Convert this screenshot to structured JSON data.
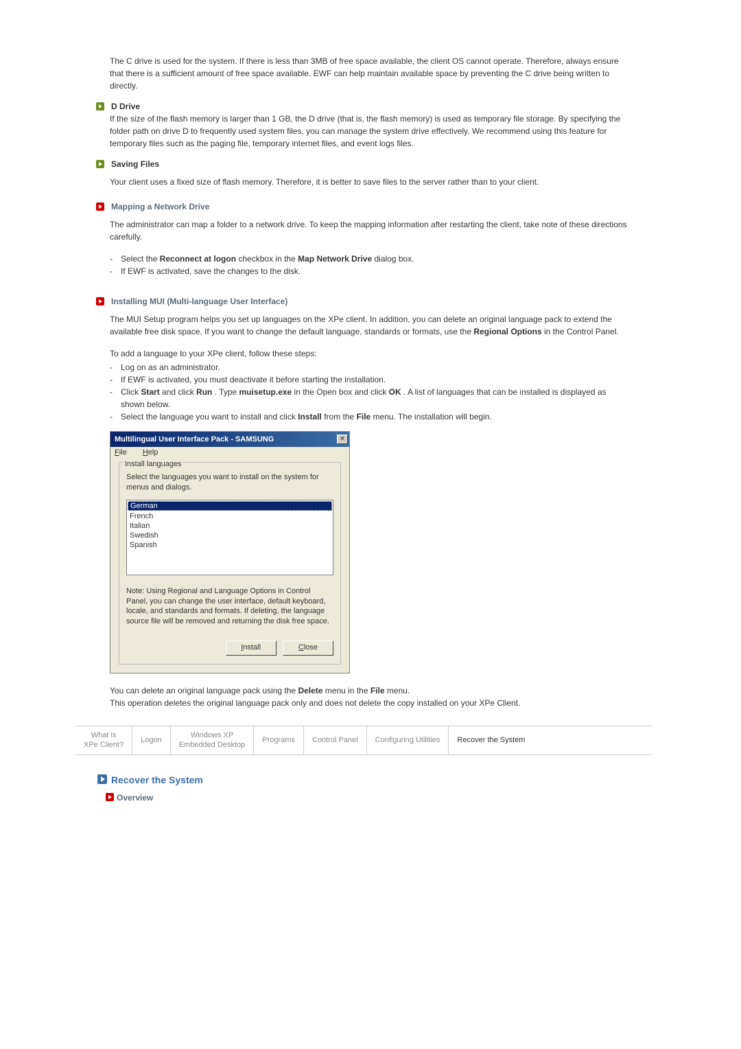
{
  "intro_paragraph": "The C drive is used for the system. If there is less than 3MB of free space available, the client OS cannot operate. Therefore, always ensure that there is a sufficient amount of free space available. EWF can help maintain available space by preventing the C drive being written to directly.",
  "ddrive": {
    "title": "D Drive",
    "text": "If the size of the flash memory is larger than 1 GB, the D drive (that is, the flash memory) is used as temporary file storage. By specifying the folder path on drive D to frequently used system files, you can manage the system drive effectively. We recommend using this feature for temporary files such as the paging file, temporary internet files, and event logs files."
  },
  "saving": {
    "title": "Saving Files",
    "text": "Your client uses a fixed size of flash memory. Therefore, it is better to save files to the server rather than to your client."
  },
  "mapping": {
    "title": "Mapping a Network Drive",
    "intro": "The administrator can map a folder to a network drive. To keep the mapping information after restarting the client, take note of these directions carefully.",
    "items": {
      "a_pre": "Select the ",
      "a_b1": "Reconnect at logon",
      "a_mid": " checkbox in the ",
      "a_b2": "Map Network Drive",
      "a_post": " dialog box.",
      "b": "If EWF is activated, save the changes to the disk."
    }
  },
  "mui": {
    "title": "Installing MUI (Multi-language User Interface)",
    "p1_a": "The MUI Setup program helps you set up languages on the XPe client. In addition, you can delete an original language pack to extend the available free disk space. If you want to change the default language, standards or formats, use the ",
    "p1_b": "Regional Options",
    "p1_c": " in the Control Panel.",
    "p2": "To add a language to your XPe client, follow these steps:",
    "steps": {
      "a": "Log on as an administrator.",
      "b": "If EWF is activated, you must deactivate it before starting the installation.",
      "c_pre": "Click ",
      "c_b1": "Start",
      "c_mid1": " and click ",
      "c_b2": "Run",
      "c_mid2": " . Type ",
      "c_b3": "muisetup.exe",
      "c_mid3": " in the Open box and click ",
      "c_b4": "OK",
      "c_post": " . A list of languages that can be installed is displayed as shown below.",
      "d_pre": "Select the language you want to install and click ",
      "d_b1": "Install",
      "d_mid": " from the ",
      "d_b2": "File",
      "d_post": " menu. The installation will begin."
    }
  },
  "dialog": {
    "title": "Multilingual User Interface Pack - SAMSUNG",
    "menu_file": "File",
    "menu_help": "Help",
    "legend": "Install languages",
    "instruction": "Select the languages you want to install on the system for menus and dialogs.",
    "languages": [
      "German",
      "French",
      "Italian",
      "Swedish",
      "Spanish"
    ],
    "note": "Note: Using Regional and Language Options in Control Panel, you can change the user interface, default keyboard, locale, and standards and formats. If deleting, the language source file will be removed and returning the disk free space.",
    "install_btn": "Install",
    "close_btn": "Close"
  },
  "after_dialog": {
    "l1_pre": "You can delete an original language pack using the ",
    "l1_b1": "Delete",
    "l1_mid": " menu in the ",
    "l1_b2": "File",
    "l1_post": " menu.",
    "l2": "This operation deletes the original language pack only and does not delete the copy installed on your XPe Client."
  },
  "tabs": {
    "t1": "What is\nXPe Client?",
    "t2": "Logon",
    "t3": "Windows XP\nEmbedded Desktop",
    "t4": "Programs",
    "t5": "Control Panel",
    "t6": "Configuring Utilities",
    "t7": "Recover the System"
  },
  "section": {
    "title": "Recover the System",
    "overview": "Overview"
  }
}
